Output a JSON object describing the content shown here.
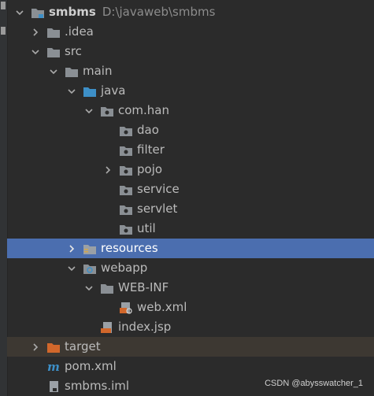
{
  "project_tree": {
    "root": {
      "label": "smbms",
      "path": "D:\\javaweb\\smbms"
    },
    "idea": "idea_placeholder",
    "nodes": {
      "idea": ".idea",
      "src": "src",
      "main": "main",
      "java": "java",
      "com_han": "com.han",
      "dao": "dao",
      "filter": "filter",
      "pojo": "pojo",
      "service": "service",
      "servlet": "servlet",
      "util": "util",
      "resources": "resources",
      "webapp": "webapp",
      "web_inf": "WEB-INF",
      "web_xml": "web.xml",
      "index_jsp": "index.jsp",
      "target": "target",
      "pom_xml": "pom.xml",
      "smbms_iml": "smbms.iml"
    }
  },
  "colors": {
    "background": "#2b2b2b",
    "selection": "#4b6eaf",
    "excluded_row": "#3d3832",
    "folder_gray": "#8a8f94",
    "source_folder_blue": "#3d8fc7",
    "excluded_folder_orange": "#d1672b"
  },
  "watermark": "CSDN @abysswatcher_1"
}
